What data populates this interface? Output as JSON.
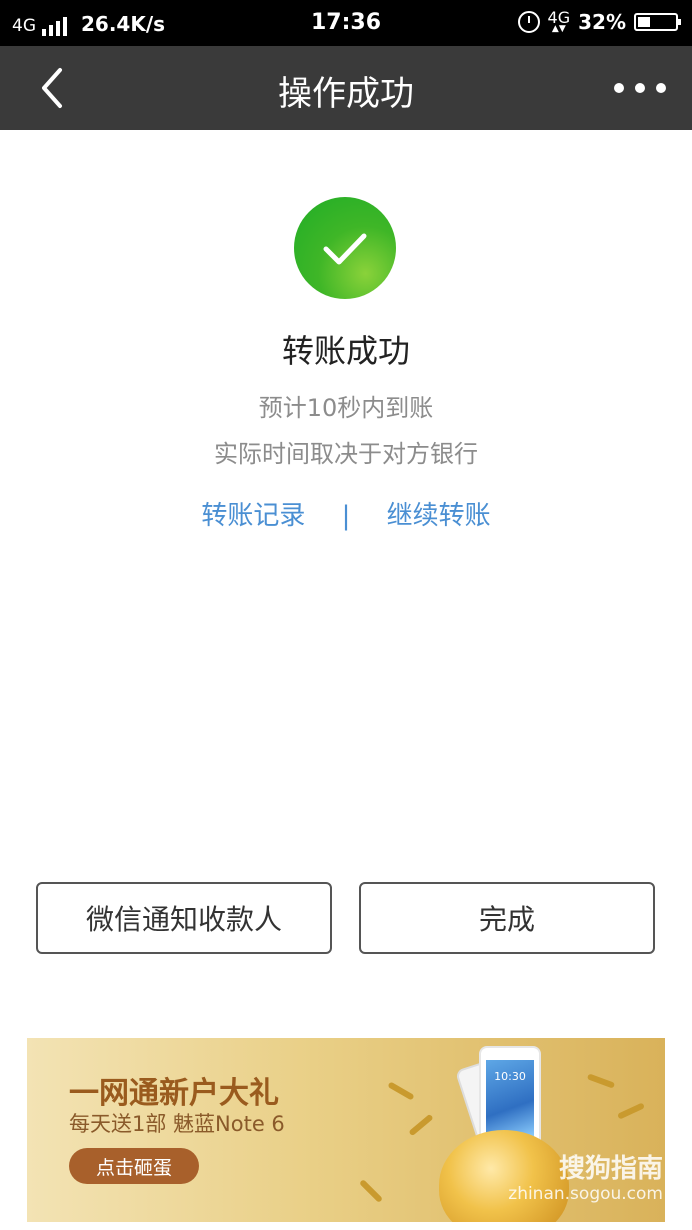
{
  "status_bar": {
    "network_left": "4G",
    "speed": "26.4K/s",
    "time": "17:36",
    "network_right": "4G",
    "battery": "32%"
  },
  "nav": {
    "title": "操作成功",
    "back_icon": "chevron-left-icon",
    "more_icon": "more-horizontal-icon"
  },
  "result": {
    "icon": "check-circle-icon",
    "icon_color": "#3fb627",
    "title": "转账成功",
    "line1": "预计10秒内到账",
    "line2": "实际时间取决于对方银行"
  },
  "links": {
    "records": "转账记录",
    "separator": "|",
    "continue": "继续转账",
    "color": "#4a8fd3"
  },
  "buttons": {
    "notify": "微信通知收款人",
    "done": "完成"
  },
  "banner": {
    "title": "一网通新户大礼",
    "subtitle": "每天送1部 魅蓝Note 6",
    "cta": "点击砸蛋",
    "phone_time": "10:30",
    "watermark_brand": "搜狗指南",
    "watermark_url": "zhinan.sogou.com"
  }
}
